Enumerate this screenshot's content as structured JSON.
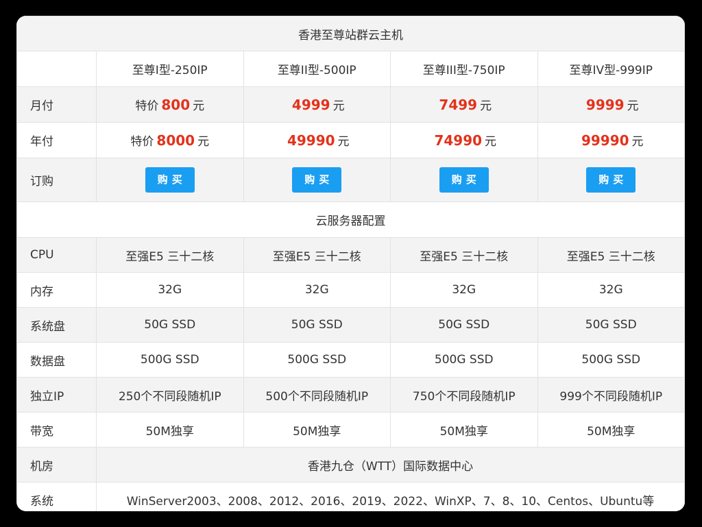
{
  "title": "香港至尊站群云主机",
  "plans": [
    "至尊I型-250IP",
    "至尊II型-500IP",
    "至尊III型-750IP",
    "至尊IV型-999IP"
  ],
  "monthly": {
    "label": "月付",
    "items": [
      {
        "prefix": "特价",
        "price": "800",
        "unit": "元"
      },
      {
        "prefix": "",
        "price": "4999",
        "unit": "元"
      },
      {
        "prefix": "",
        "price": "7499",
        "unit": "元"
      },
      {
        "prefix": "",
        "price": "9999",
        "unit": "元"
      }
    ]
  },
  "yearly": {
    "label": "年付",
    "items": [
      {
        "prefix": "特价",
        "price": "8000",
        "unit": "元"
      },
      {
        "prefix": "",
        "price": "49990",
        "unit": "元"
      },
      {
        "prefix": "",
        "price": "74990",
        "unit": "元"
      },
      {
        "prefix": "",
        "price": "99990",
        "unit": "元"
      }
    ]
  },
  "order": {
    "label": "订购",
    "button": "购买"
  },
  "config_title": "云服务器配置",
  "specs": [
    {
      "label": "CPU",
      "values": [
        "至强E5 三十二核",
        "至强E5 三十二核",
        "至强E5 三十二核",
        "至强E5 三十二核"
      ]
    },
    {
      "label": "内存",
      "values": [
        "32G",
        "32G",
        "32G",
        "32G"
      ]
    },
    {
      "label": "系统盘",
      "values": [
        "50G SSD",
        "50G SSD",
        "50G SSD",
        "50G SSD"
      ]
    },
    {
      "label": "数据盘",
      "values": [
        "500G SSD",
        "500G SSD",
        "500G SSD",
        "500G SSD"
      ]
    },
    {
      "label": "独立IP",
      "values": [
        "250个不同段随机IP",
        "500个不同段随机IP",
        "750个不同段随机IP",
        "999个不同段随机IP"
      ]
    },
    {
      "label": "带宽",
      "values": [
        "50M独享",
        "50M独享",
        "50M独享",
        "50M独享"
      ]
    }
  ],
  "datacenter": {
    "label": "机房",
    "value": "香港九仓（WTT）国际数据中心"
  },
  "os": {
    "label": "系统",
    "value": "WinServer2003、2008、2012、2016、2019、2022、WinXP、7、8、10、Centos、Ubuntu等"
  }
}
